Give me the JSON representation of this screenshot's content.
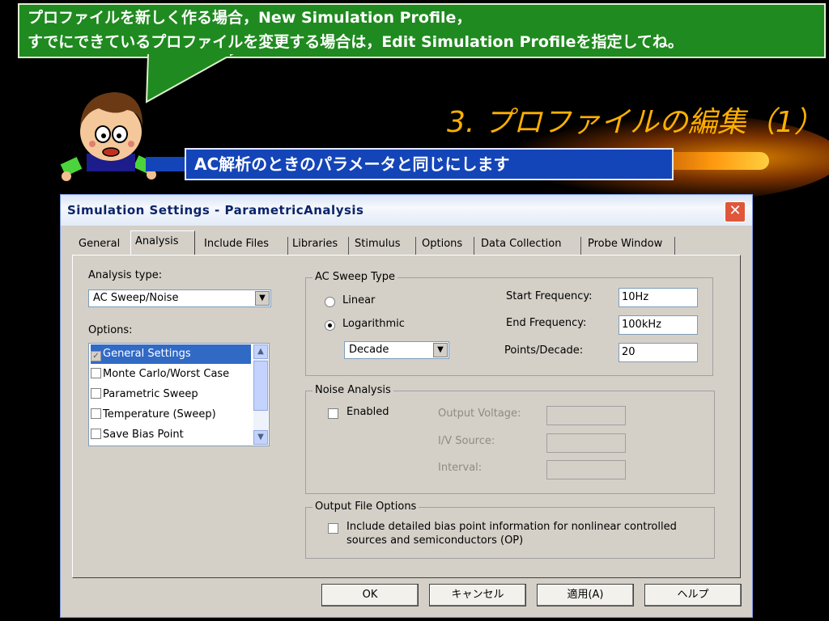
{
  "bubble": {
    "line1": "プロファイルを新しく作る場合，New Simulation Profile，",
    "line2": "すでにできているプロファイルを変更する場合は，Edit Simulation Profileを指定してね。"
  },
  "slide_title": "3. プロファイルの編集（1）",
  "subtitle": "AC解析のときのパラメータと同じにします",
  "dialog": {
    "title": "Simulation Settings - ParametricAnalysis",
    "close": "✕",
    "tabs": [
      "General",
      "Analysis",
      "Include Files",
      "Libraries",
      "Stimulus",
      "Options",
      "Data Collection",
      "Probe Window"
    ],
    "analysis_type_label": "Analysis type:",
    "analysis_type_value": "AC Sweep/Noise",
    "options_label": "Options:",
    "options": [
      {
        "label": "General Settings",
        "checked": true,
        "selected": true
      },
      {
        "label": "Monte Carlo/Worst Case",
        "checked": false
      },
      {
        "label": "Parametric Sweep",
        "checked": false
      },
      {
        "label": "Temperature (Sweep)",
        "checked": false
      },
      {
        "label": "Save Bias Point",
        "checked": false
      }
    ],
    "ac_sweep": {
      "group_title": "AC Sweep Type",
      "linear": "Linear",
      "logarithmic": "Logarithmic",
      "selected": "Logarithmic",
      "log_unit": "Decade",
      "start_label": "Start Frequency:",
      "start_value": "10Hz",
      "end_label": "End Frequency:",
      "end_value": "100kHz",
      "points_label": "Points/Decade:",
      "points_value": "20"
    },
    "noise": {
      "group_title": "Noise Analysis",
      "enabled_label": "Enabled",
      "output_voltage_label": "Output Voltage:",
      "iv_source_label": "I/V Source:",
      "interval_label": "Interval:"
    },
    "output_file": {
      "group_title": "Output File Options",
      "include_line1": "Include detailed bias point information for nonlinear controlled",
      "include_line2": "sources and semiconductors (OP)"
    },
    "buttons": {
      "ok": "OK",
      "cancel": "キャンセル",
      "apply": "適用(A)",
      "help": "ヘルプ"
    }
  },
  "colors": {
    "bubble": "#1f8a1f",
    "title": "#ffb000",
    "subtitle_bar": "#1445b8",
    "dialog_face": "#d4d0c8",
    "selection": "#316ac5"
  }
}
